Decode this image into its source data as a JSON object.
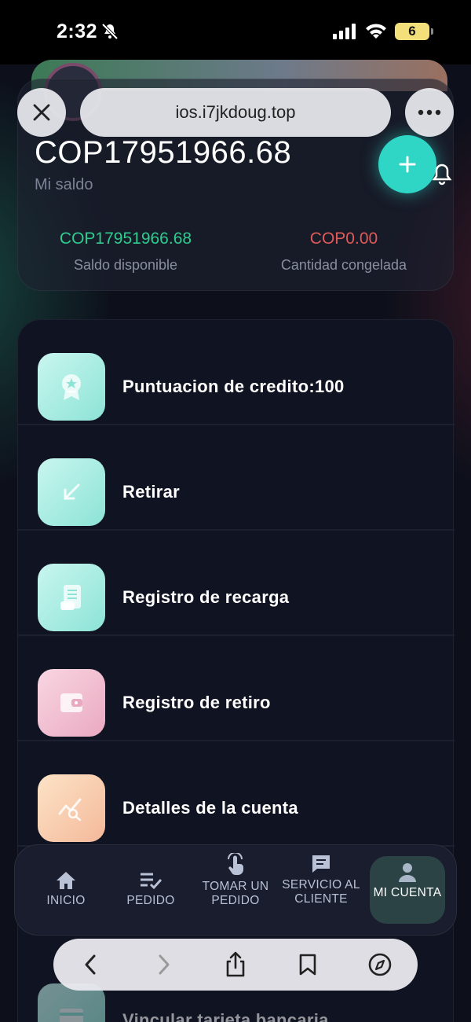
{
  "status_bar": {
    "time": "2:32",
    "battery": "6"
  },
  "browser": {
    "url": "ios.i7jkdoug.top"
  },
  "account": {
    "balance": "COP17951966.68",
    "balance_label": "Mi saldo",
    "available_amount": "COP17951966.68",
    "available_label": "Saldo disponible",
    "frozen_amount": "COP0.00",
    "frozen_label": "Cantidad congelada"
  },
  "menu": {
    "items": [
      {
        "label": "Puntuacion de credito:100",
        "icon": "badge-icon"
      },
      {
        "label": "Retirar",
        "icon": "arrow-down-left-icon"
      },
      {
        "label": "Registro de recarga",
        "icon": "receipt-icon"
      },
      {
        "label": "Registro de retiro",
        "icon": "wallet-icon"
      },
      {
        "label": "Detalles de la cuenta",
        "icon": "chart-search-icon"
      },
      {
        "label": "Vincular tarjeta bancaria",
        "icon": "card-icon"
      }
    ]
  },
  "tabs": [
    {
      "label": "INICIO",
      "icon": "home-icon"
    },
    {
      "label": "PEDIDO",
      "icon": "list-check-icon"
    },
    {
      "label": "TOMAR UN PEDIDO",
      "icon": "touch-icon"
    },
    {
      "label": "SERVICIO AL CLIENTE",
      "icon": "chat-icon"
    },
    {
      "label": "MI CUENTA",
      "icon": "person-icon",
      "active": true
    }
  ],
  "colors": {
    "accent": "#2fd6c6",
    "available": "#2ecc8f",
    "frozen": "#e05a5a"
  }
}
